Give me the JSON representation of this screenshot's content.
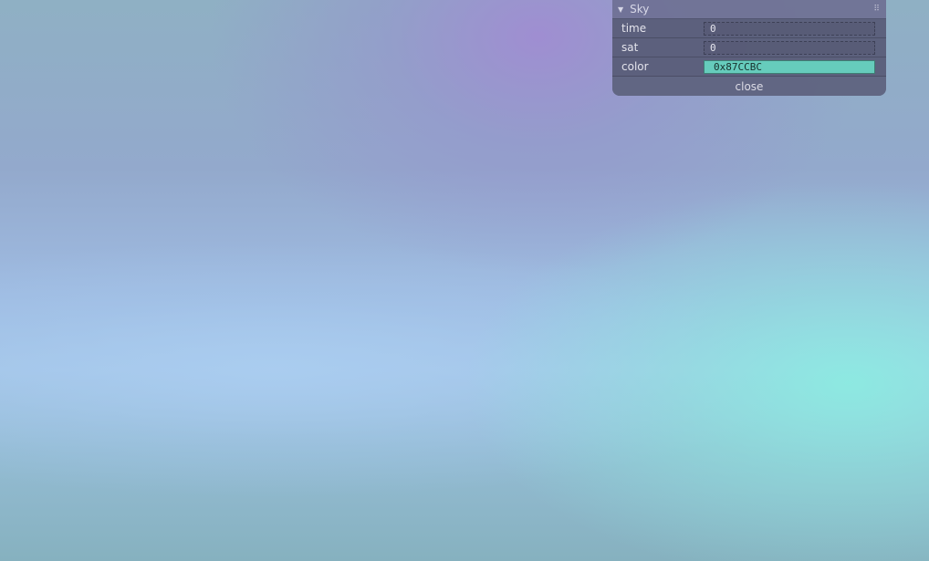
{
  "gui": {
    "folder_title": "Sky",
    "controllers": [
      {
        "label": "time",
        "value": "0"
      },
      {
        "label": "sat",
        "value": "0"
      },
      {
        "label": "color",
        "value": "0x87CCBC"
      }
    ],
    "close_label": "close"
  },
  "colors": {
    "color_swatch": "#66CCBC"
  }
}
